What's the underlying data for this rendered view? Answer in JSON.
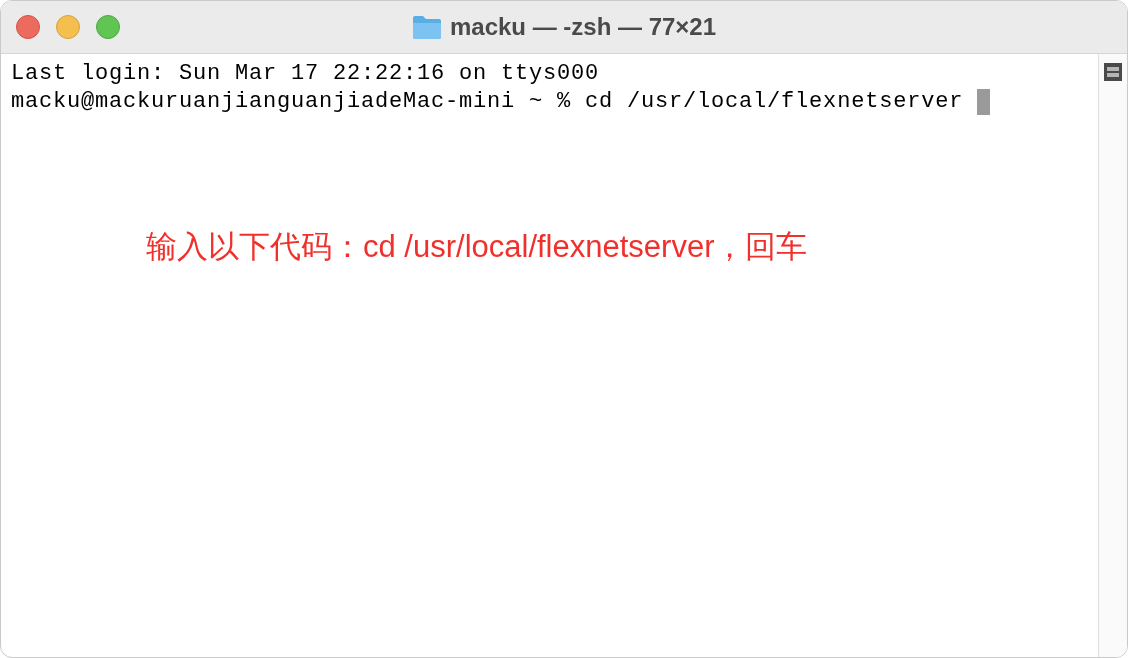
{
  "window": {
    "title": "macku — -zsh — 77×21"
  },
  "terminal": {
    "lines": [
      "Last login: Sun Mar 17 22:22:16 on ttys000",
      "macku@mackuruanjianguanjiadeMac-mini ~ % cd /usr/local/flexnetserver"
    ]
  },
  "annotation": "输入以下代码：cd /usr/local/flexnetserver，回车"
}
